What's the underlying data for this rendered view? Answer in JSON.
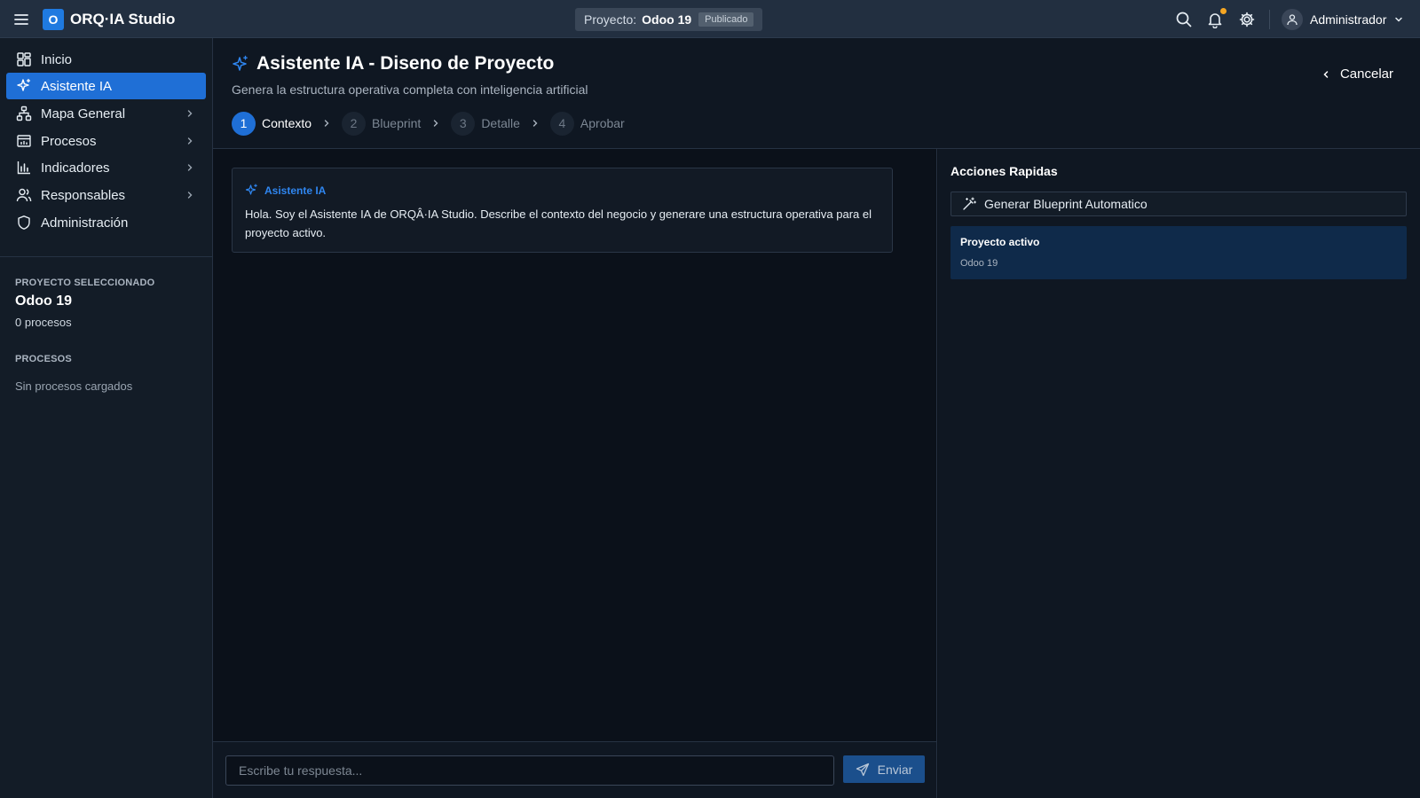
{
  "app": {
    "logo_letter": "O",
    "title": "ORQ·IA Studio"
  },
  "topbar": {
    "project_label": "Proyecto:",
    "project_name": "Odoo 19",
    "project_status": "Publicado",
    "user_name": "Administrador",
    "notification_dot_color": "#f5a623"
  },
  "sidebar": {
    "items": [
      {
        "label": "Inicio",
        "icon": "grid-icon",
        "chevron": false,
        "active": false
      },
      {
        "label": "Asistente IA",
        "icon": "sparkles-icon",
        "chevron": false,
        "active": true
      },
      {
        "label": "Mapa General",
        "icon": "sitemap-icon",
        "chevron": true,
        "active": false
      },
      {
        "label": "Procesos",
        "icon": "process-icon",
        "chevron": true,
        "active": false
      },
      {
        "label": "Indicadores",
        "icon": "bar-chart-icon",
        "chevron": true,
        "active": false
      },
      {
        "label": "Responsables",
        "icon": "users-icon",
        "chevron": true,
        "active": false
      },
      {
        "label": "Administración",
        "icon": "shield-icon",
        "chevron": false,
        "active": false
      }
    ],
    "selected_project_label": "PROYECTO SELECCIONADO",
    "selected_project_name": "Odoo 19",
    "selected_project_count": "0 procesos",
    "processes_label": "PROCESOS",
    "processes_empty": "Sin procesos cargados"
  },
  "header": {
    "title": "Asistente IA - Diseno de Proyecto",
    "subtitle": "Genera la estructura operativa completa con inteligencia artificial",
    "cancel_label": "Cancelar",
    "steps": [
      {
        "num": "1",
        "label": "Contexto",
        "active": true
      },
      {
        "num": "2",
        "label": "Blueprint",
        "active": false
      },
      {
        "num": "3",
        "label": "Detalle",
        "active": false
      },
      {
        "num": "4",
        "label": "Aprobar",
        "active": false
      }
    ]
  },
  "chat": {
    "message_author": "Asistente IA",
    "message_text": "Hola. Soy el Asistente IA de ORQÂ·IA Studio. Describe el contexto del negocio y generare una estructura operativa para el proyecto activo.",
    "input_placeholder": "Escribe tu respuesta...",
    "input_value": "",
    "send_label": "Enviar"
  },
  "quick_actions": {
    "title": "Acciones Rapidas",
    "generate_label": "Generar Blueprint Automatico",
    "active_project_label": "Proyecto activo",
    "active_project_value": "Odoo 19"
  },
  "colors": {
    "accent": "#1f6fd6",
    "topbar_bg": "#222f40",
    "sidebar_bg": "#131c27",
    "main_bg": "#0b111a"
  }
}
